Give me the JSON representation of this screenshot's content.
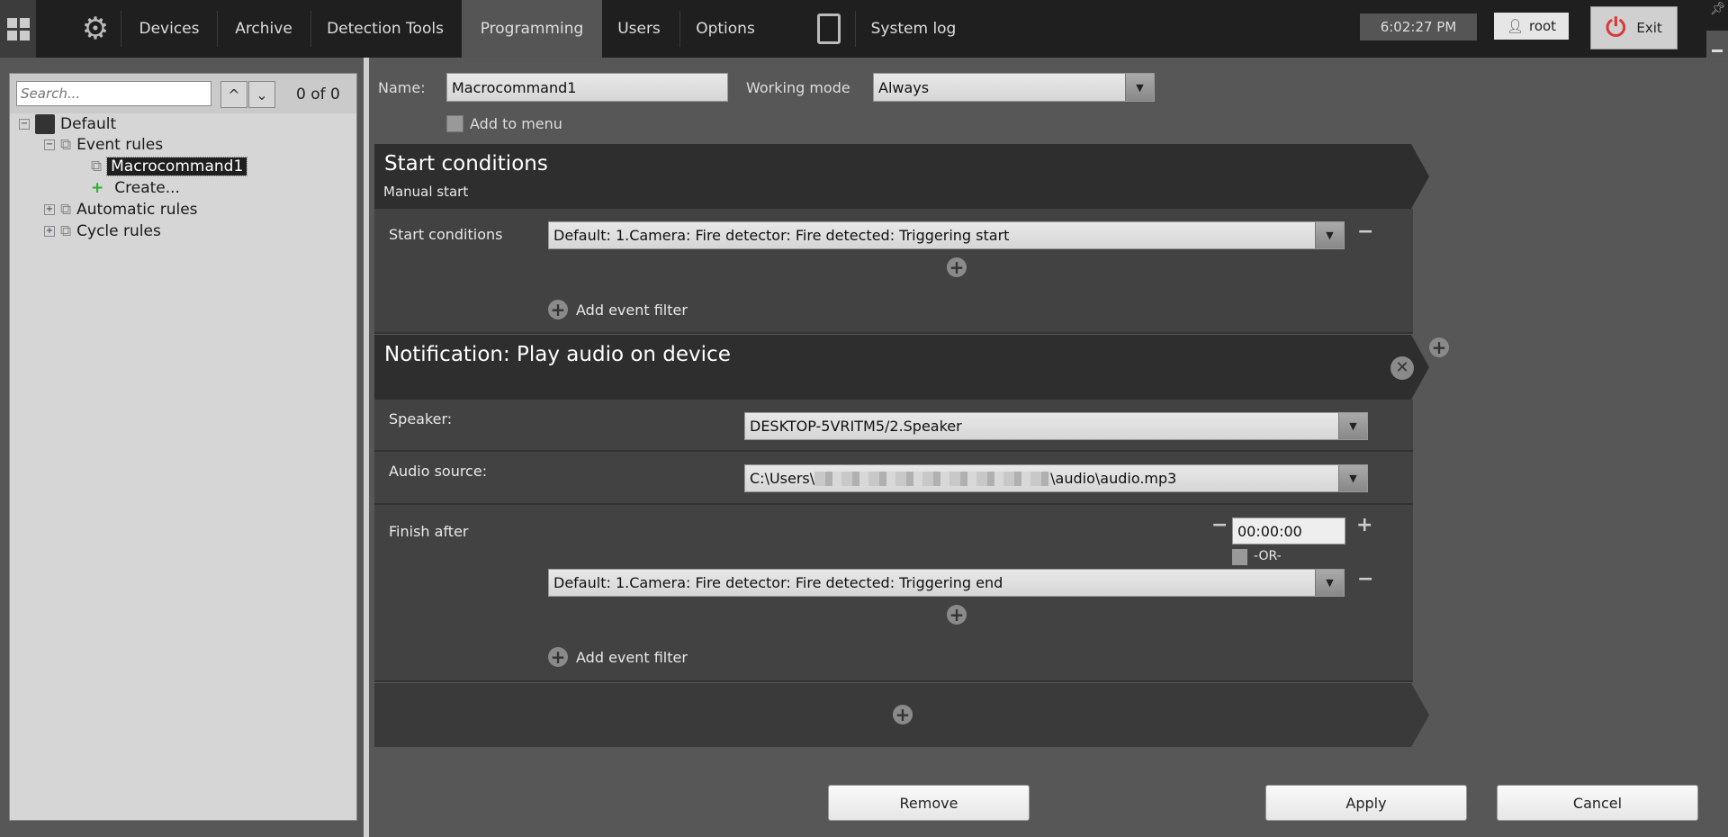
{
  "topbar": {
    "tabs": [
      "Devices",
      "Archive",
      "Detection Tools",
      "Programming",
      "Users",
      "Options"
    ],
    "active_tab": "Programming",
    "system_log": "System log",
    "clock": "6:02:27 PM",
    "user": "root",
    "exit": "Exit"
  },
  "sidebar": {
    "search_placeholder": "Search...",
    "match_count": "0 of 0",
    "tree": {
      "root": "Default",
      "event_rules": "Event rules",
      "macro": "Macrocommand1",
      "create": "Create...",
      "automatic": "Automatic rules",
      "cycle": "Cycle rules"
    }
  },
  "form": {
    "name_label": "Name:",
    "name_value": "Macrocommand1",
    "mode_label": "Working mode",
    "mode_value": "Always",
    "add_to_menu": "Add to menu"
  },
  "start": {
    "title": "Start conditions",
    "subtitle": "Manual start",
    "label": "Start conditions",
    "condition": "Default: 1.Camera: Fire detector: Fire detected: Triggering start",
    "add_filter": "Add event filter"
  },
  "notification": {
    "title": "Notification: Play audio on device",
    "speaker_label": "Speaker:",
    "speaker_value": "DESKTOP-5VRITM5/2.Speaker",
    "audio_label": "Audio source:",
    "audio_prefix": "C:\\Users\\",
    "audio_suffix": "\\audio\\audio.mp3",
    "finish_label": "Finish after",
    "time": "00:00:00",
    "or": "-OR-",
    "end_condition": "Default: 1.Camera: Fire detector: Fire detected: Triggering end",
    "add_filter": "Add event filter"
  },
  "buttons": {
    "remove": "Remove",
    "apply": "Apply",
    "cancel": "Cancel"
  },
  "colors": {
    "topbar": "#1f1f1f",
    "active_tab": "#555555",
    "exit_icon": "#d83a3a",
    "create_plus": "#22b422"
  }
}
